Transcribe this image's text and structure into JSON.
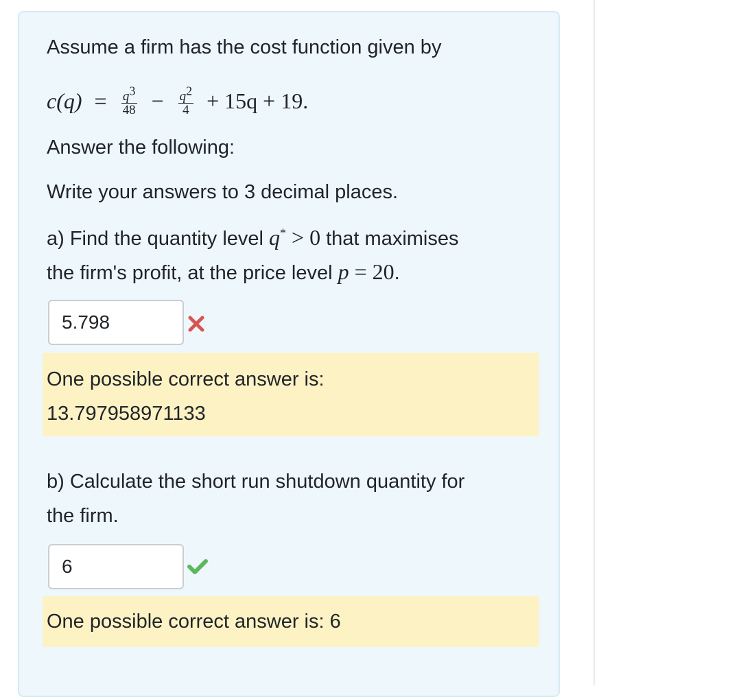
{
  "question": {
    "intro": "Assume a firm has the cost function given by",
    "cost_function": {
      "lhs": "c(q)",
      "equals": "=",
      "term1_num": "q",
      "term1_num_exp": "3",
      "term1_den": "48",
      "minus": "−",
      "term2_num": "q",
      "term2_num_exp": "2",
      "term2_den": "4",
      "rest": "+ 15q + 19."
    },
    "instruction1": "Answer the following:",
    "instruction2": "Write your answers to 3 decimal places."
  },
  "part_a": {
    "line1_text": "a) Find the quantity level ",
    "line1_math": "q",
    "line1_math_exp": "*",
    "line1_math_rest": " > 0",
    "line1_tail": " that maximises",
    "line2_text": "the firm's profit, at the price level ",
    "line2_math": "p",
    "line2_math_rest": " = 20",
    "line2_tail": ".",
    "answer_value": "5.798",
    "status": "incorrect",
    "status_color": "#d9534f",
    "status_icon": "cross-icon",
    "feedback_label": "One possible correct answer is:",
    "feedback_value": "13.797958971133"
  },
  "part_b": {
    "line1": "b) Calculate the short run shutdown quantity for",
    "line2": "the firm.",
    "answer_value": "6",
    "status": "correct",
    "status_color": "#5cb85c",
    "status_icon": "check-icon",
    "feedback_text": "One possible correct answer is: 6"
  },
  "colors": {
    "card_background": "#eef7fb",
    "feedback_background": "#fdf2c4"
  }
}
